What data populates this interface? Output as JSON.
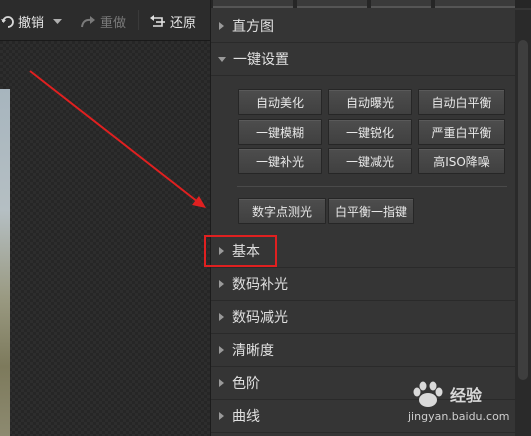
{
  "toolbar": {
    "undo_label": "撤销",
    "redo_label": "重做",
    "restore_label": "还原"
  },
  "panel": {
    "sections": {
      "histogram": "直方图",
      "one_click": "一键设置",
      "basic": "基本",
      "digital_fill": "数码补光",
      "digital_reduce": "数码减光",
      "clarity": "清晰度",
      "levels": "色阶",
      "curves": "曲线"
    },
    "buttons": {
      "auto_beautify": "自动美化",
      "auto_exposure": "自动曝光",
      "auto_wb": "自动白平衡",
      "deblur": "一键模糊",
      "sharpen": "一键锐化",
      "strict_wb": "严重白平衡",
      "fill_light": "一键补光",
      "reduce_light": "一键减光",
      "high_iso_denoise": "高ISO降噪",
      "spot_metering": "数字点测光",
      "wb_one_finger": "白平衡一指键"
    }
  },
  "watermark": {
    "brand": "经验",
    "url": "jingyan.baidu.com"
  },
  "colors": {
    "annotation_red": "#e02020",
    "panel_bg": "#353535",
    "button_bg": "#454545"
  }
}
